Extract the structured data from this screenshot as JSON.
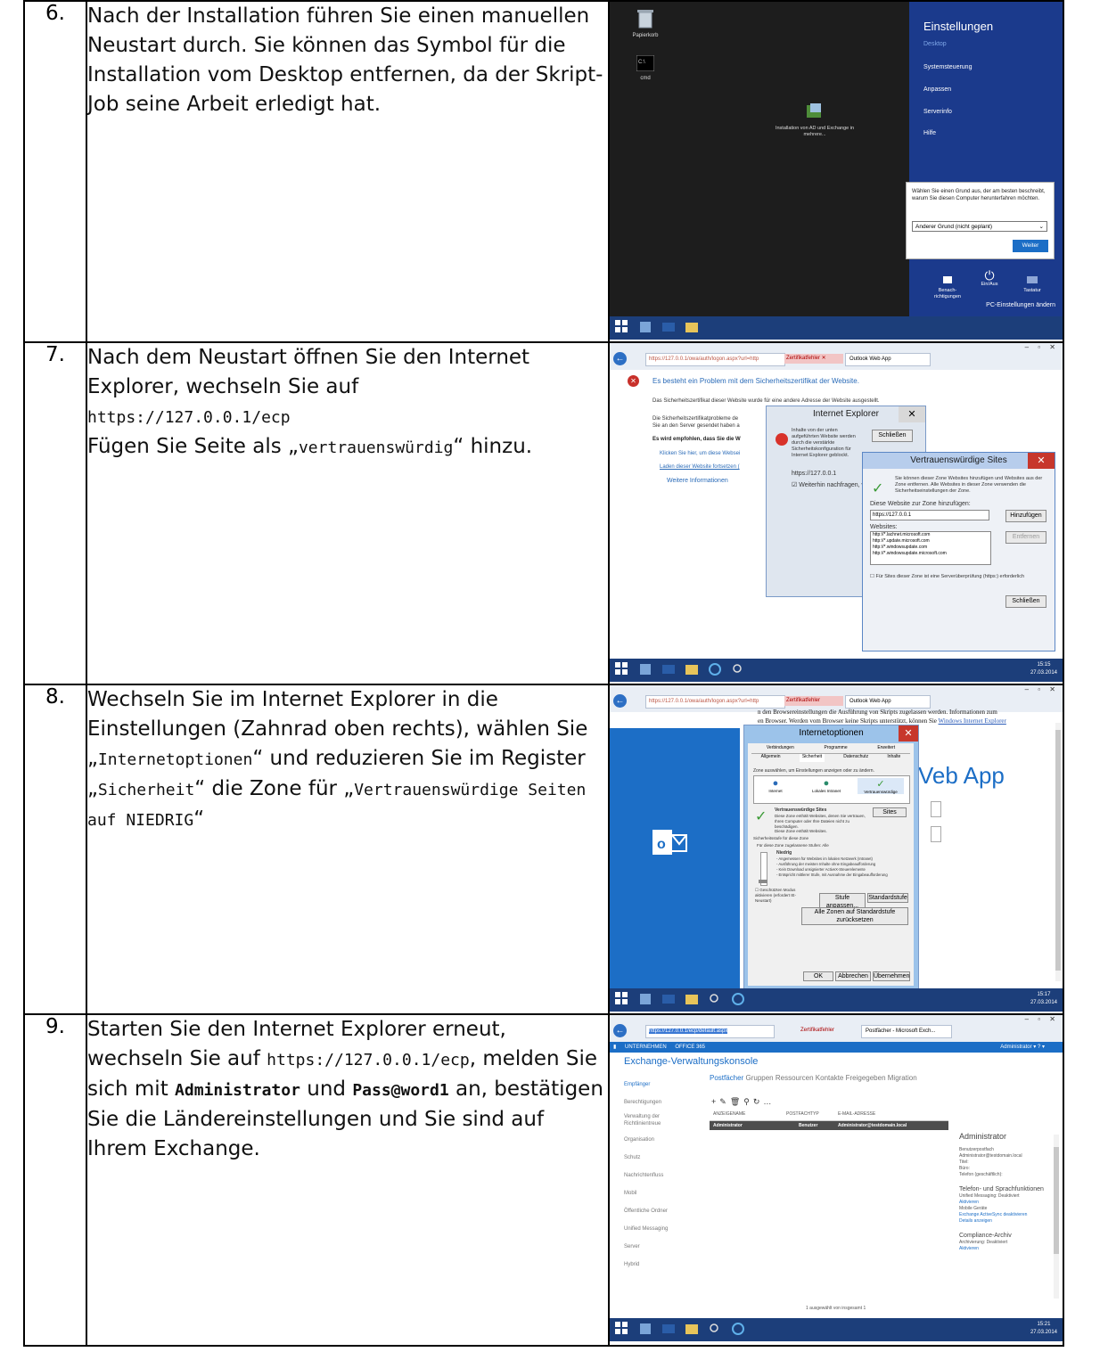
{
  "rows": [
    {
      "num": "6.",
      "text": "Nach der Installation führen Sie einen manuellen Neustart durch. Sie können das Symbol für die Installation vom Desktop entfernen, da der Skript-Job seine Arbeit erledigt hat.",
      "screenshot": {
        "desktop_icons": [
          "Papierkorb",
          "cmd"
        ],
        "installer_icon_label": "Installation von AD und Exchange in mehrere...",
        "charm_title": "Einstellungen",
        "charm_items": [
          "Desktop",
          "Systemsteuerung",
          "Anpassen",
          "Serverinfo",
          "Hilfe"
        ],
        "shutdown_prompt": "Wählen Sie einen Grund aus, der am besten beschreibt, warum Sie diesen Computer herunterfahren möchten.",
        "shutdown_reason": "Anderer Grund (nicht geplant)",
        "continue_button": "Weiter",
        "bottom_icons": [
          "Benach- richtigungen",
          "Ein/Aus",
          "Tastatur"
        ],
        "pc_settings": "PC-Einstellungen ändern"
      }
    },
    {
      "num": "7.",
      "text_a": "Nach dem Neustart öffnen Sie den Internet Explorer, wechseln Sie auf",
      "url": "https://127.0.0.1/ecp",
      "text_b_pre": "Fügen Sie Seite als „",
      "code": "vertrauenswürdig",
      "text_b_post": "“ hinzu.",
      "screenshot": {
        "address": "https://127.0.0.1/owa/auth/logon.aspx?url=http",
        "cert_error": "Zertifikatfehler",
        "tab_title": "Outlook Web App",
        "headline": "Es besteht ein Problem mit dem Sicherheitszertifikat der Website.",
        "subline": "Das Sicherheitszertifikat dieser Website wurde für eine andere Adresse der Website ausgestellt.",
        "body_fragment_1": "Die Sicherheitszertifikatprobleme de",
        "body_fragment_2": "Sie an den Server gesendet haben a",
        "recommend": "Es wird empfohlen, dass Sie die W",
        "link1": "Klicken Sie hier, um diese Websei",
        "link2": "Laden dieser Website fortsetzen (",
        "more_info": "Weitere Informationen",
        "ie_dialog_title": "Internet Explorer",
        "ie_dialog_msg": "Inhalte von der unten aufgeführten Website werden durch die verstärkte Sicherheitskonfiguration für Internet Explorer geblockt.",
        "ie_dialog_site": "https://127.0.0.1",
        "ie_dialog_close": "Schließen",
        "ie_dialog_check": "Weiterhin nachfragen, wenn Websiteinha",
        "trusted_title": "Vertrauenswürdige Sites",
        "trusted_info": "Sie können dieser Zone Websites hinzufügen und Websites aus der Zone entfernen. Alle Websites in dieser Zone verwenden die Sicherheitseinstellungen der Zone.",
        "trusted_add_label": "Diese Website zur Zone hinzufügen:",
        "trusted_add_value": "https://127.0.0.1",
        "trusted_add_btn": "Hinzufügen",
        "trusted_sites_label": "Websites:",
        "trusted_sites": [
          "http://*.lachnet.microsoft.com",
          "http://*.update.microsoft.com",
          "http://*.windowsupdate.com",
          "http://*.windowsupdate.microsoft.com"
        ],
        "trusted_remove_btn": "Entfernen",
        "trusted_https_check": "Für Sites dieser Zone ist eine Serverüberprüfung (https:) erforderlich",
        "trusted_close": "Schließen",
        "clock_time": "15:15",
        "clock_date": "27.03.2014"
      }
    },
    {
      "num": "8.",
      "text_a": "Wechseln Sie im Internet Explorer in die Einstellungen (Zahnrad oben rechts), wählen Sie „",
      "code1": "Internetoptionen",
      "text_b": "“ und reduzieren Sie im Register „",
      "code2": "Sicherheit",
      "text_c": "“ die Zone für „",
      "code3": "Vertrauenswürdige Seiten auf NIEDRIG",
      "text_d": "“",
      "screenshot": {
        "address": "https://127.0.0.1/owa/auth/logon.aspx?url=http",
        "cert_error": "Zertifikatfehler",
        "tab_title": "Outlook Web App",
        "bg_text_1": "n den Browsereinstellungen die Ausführung von Skripts zugelassen werden. Informationen zum",
        "bg_text_2": "en Browser. Werden vom Browser keine Skripts unterstützt, können Sie",
        "bg_link": "Windows Internet Explorer",
        "owa_fragment": "Veb App",
        "dialog_title": "Internetoptionen",
        "tabs_top": [
          "Verbindungen",
          "Programme",
          "Erweitert"
        ],
        "tabs_bottom": [
          "Allgemein",
          "Sicherheit",
          "Datenschutz",
          "Inhalte"
        ],
        "zone_prompt": "Zone auswählen, um Einstellungen anzeigen oder zu ändern.",
        "zones": [
          "Internet",
          "Lokales Intranet",
          "Vertrauenswürdige"
        ],
        "zone_name": "Vertrauenswürdige Sites",
        "zone_desc": "Diese Zone enthält Websites, denen Sie vertrauen, Ihren Computer oder Ihre Dateien nicht zu beschädigen.",
        "zone_sites_btn": "Sites",
        "zone_contains": "Diese Zone enthält Websites.",
        "level_group": "Sicherheitsstufe für diese Zone",
        "level_allowed": "Für diese Zone zugelassene Stufen: Alle",
        "level_name": "Niedrig",
        "level_lines": [
          "- Angemessen für Websites im lokalen Netzwerk (Intranet)",
          "- Ausführung der meisten Inhalte ohne Eingabeaufforderung",
          "- Kein Download unsignierter ActiveX-Steuerelemente",
          "- Entspricht mittlerer Stufe, mit Ausnahme der Eingabeaufforderung"
        ],
        "protected_mode": "Geschützten Modus aktivieren (erfordert IE-Neustart)",
        "custom_level_btn": "Stufe anpassen...",
        "default_level_btn": "Standardstufe",
        "reset_all_btn": "Alle Zonen auf Standardstufe zurücksetzen",
        "ok_btn": "OK",
        "cancel_btn": "Abbrechen",
        "apply_btn": "Übernehmen",
        "clock_time": "15:17",
        "clock_date": "27.03.2014"
      }
    },
    {
      "num": "9.",
      "text_a": "Starten Sie den Internet Explorer erneut, wechseln Sie auf",
      "url": "https://127.0.0.1/ecp",
      "text_b": ", melden Sie sich mit",
      "user": "Administrator",
      "text_c": "und",
      "password": "Pass@word1",
      "text_d": "an, bestätigen Sie die Ländereinstellungen und Sie sind auf Ihrem Exchange.",
      "screenshot": {
        "address": "https://127.0.0.1/ecp/default.aspx",
        "cert_error": "Zertifikatfehler",
        "tab_title": "Postfächer - Microsoft Exch...",
        "top_nav": [
          "UNTERNEHMEN",
          "OFFICE 365"
        ],
        "admin_menu": "Administrator",
        "console_title": "Exchange-Verwaltungskonsole",
        "left_nav": [
          "Empfänger",
          "Berechtigungen",
          "Verwaltung der Richtlinientreue",
          "Organisation",
          "Schutz",
          "Nachrichtenfluss",
          "Mobil",
          "Öffentliche Ordner",
          "Unified Messaging",
          "Server",
          "Hybrid"
        ],
        "sub_tabs": [
          "Postfächer",
          "Gruppen",
          "Ressourcen",
          "Kontakte",
          "Freigegeben",
          "Migration"
        ],
        "columns": [
          "ANZEIGENAME",
          "POSTFACHTYP",
          "E-MAIL-ADRESSE"
        ],
        "row": [
          "Administrator",
          "Benutzer",
          "Administrator@testdomain.local"
        ],
        "detail_title": "Administrator",
        "detail_lines": [
          "Benutzerpostfach",
          "Administrator@testdomain.local",
          "Titel:",
          "Büro:",
          "Telefon (geschäftlich):"
        ],
        "phone_title": "Telefon- und Sprachfunktionen",
        "phone_lines": [
          "Unified Messaging: Deaktiviert"
        ],
        "phone_link": "Aktivieren",
        "mobile_label": "Mobile Geräte",
        "mobile_links": [
          "Exchange ActiveSync deaktivieren",
          "Details anzeigen"
        ],
        "compliance_title": "Compliance-Archiv",
        "compliance_line": "Archivierung: Deaktiviert",
        "compliance_link": "Aktivieren",
        "footer": "1 ausgewählt von insgesamt 1",
        "clock_time": "15:21",
        "clock_date": "27.03.2014"
      }
    }
  ],
  "colors": {
    "desktop": "#1d1d1d",
    "charm": "#1b3a8c",
    "win_blue": "#1c6ec6",
    "taskbar": "#1c3e7a",
    "link": "#2a6bb8"
  }
}
